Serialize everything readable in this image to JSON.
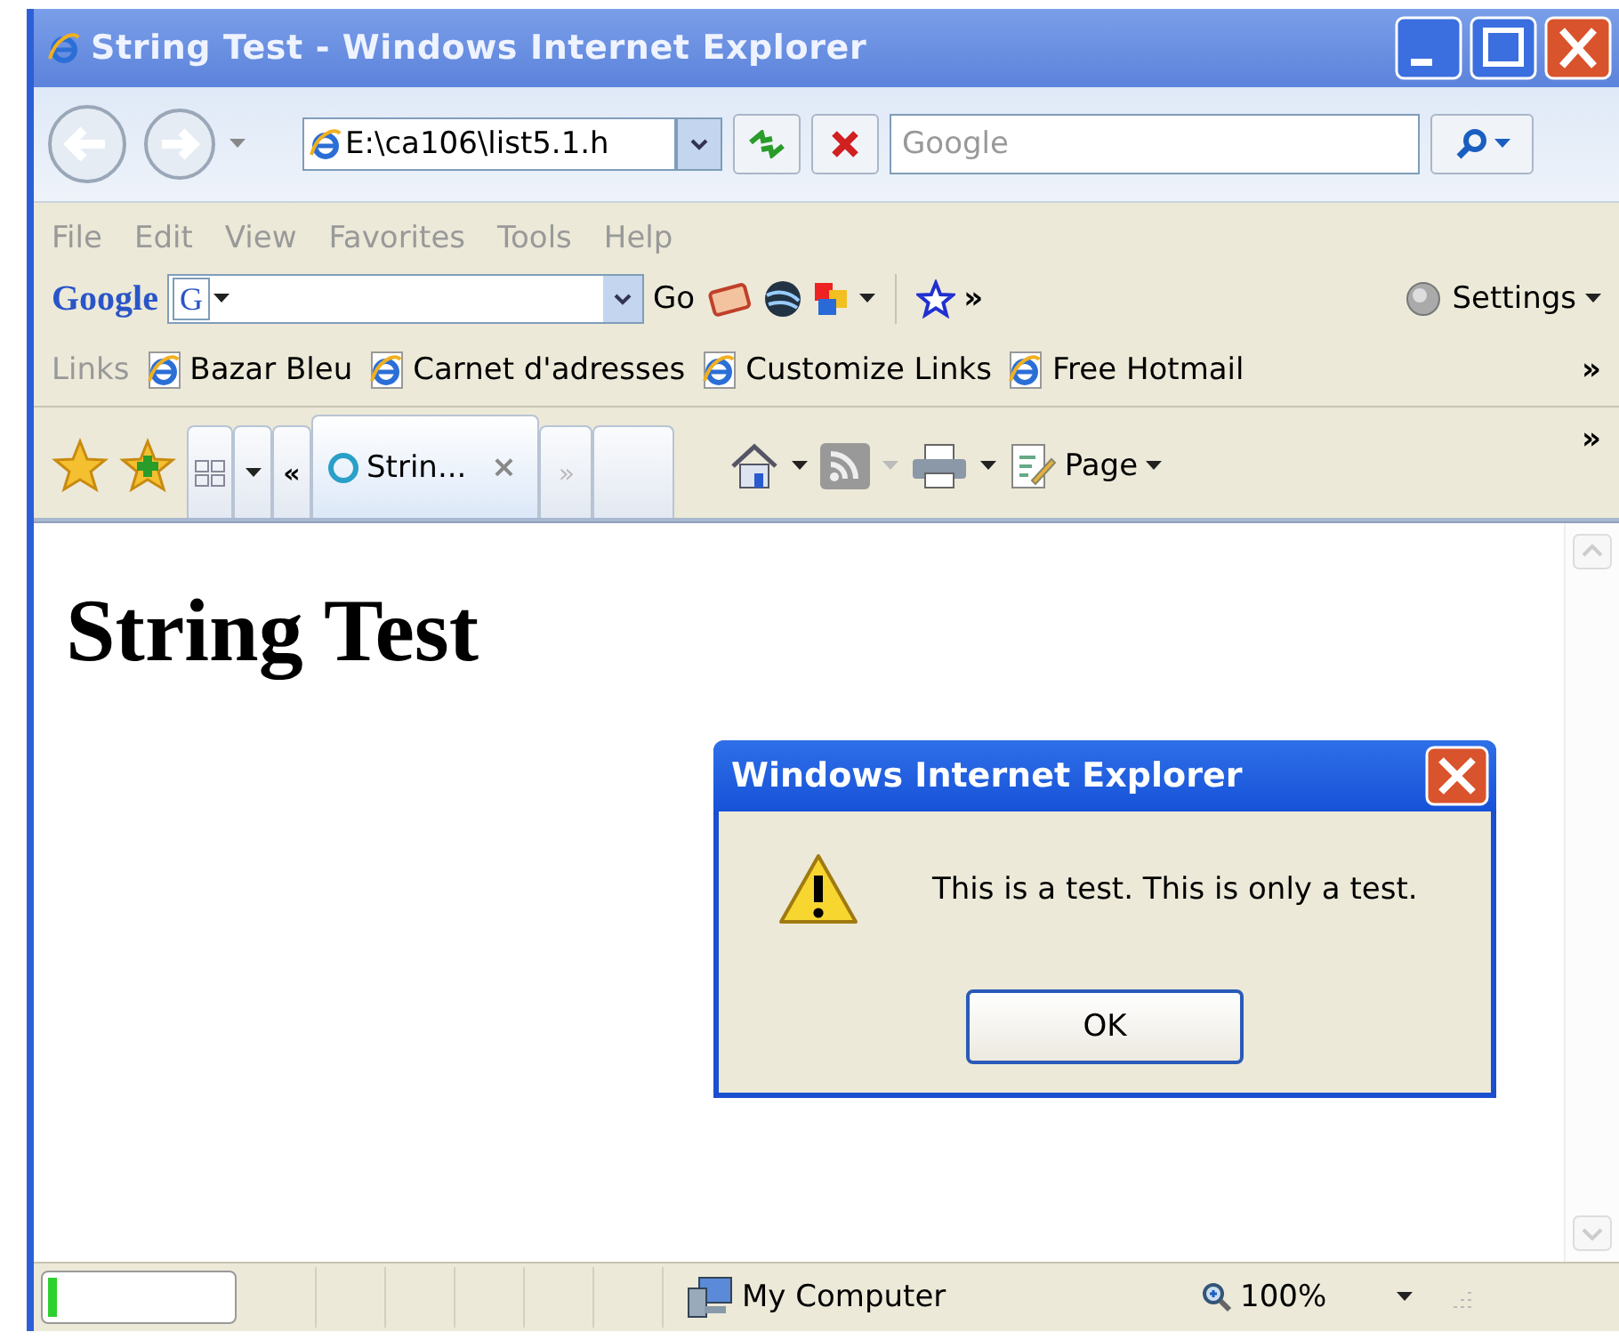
{
  "window": {
    "title": "String Test - Windows Internet Explorer"
  },
  "address_bar": {
    "value": "E:\\ca106\\list5.1.h",
    "search_placeholder": "Google"
  },
  "menu": [
    "File",
    "Edit",
    "View",
    "Favorites",
    "Tools",
    "Help"
  ],
  "google_toolbar": {
    "logo": "Google",
    "g_button": "G",
    "go": "Go",
    "more": "»",
    "settings": "Settings"
  },
  "links_bar": {
    "label": "Links",
    "items": [
      "Bazar Bleu",
      "Carnet d'adresses",
      "Customize Links",
      "Free Hotmail"
    ],
    "more": "»"
  },
  "command_bar": {
    "back_list": "«",
    "tabs": [
      {
        "label": "Strin...",
        "close": "×",
        "selected": true
      }
    ],
    "forward_list": "»",
    "page": "Page",
    "more": "»"
  },
  "content": {
    "heading": "String Test"
  },
  "dialog": {
    "title": "Windows Internet Explorer",
    "message": "This is a test. This is only a test.",
    "button": "OK"
  },
  "status_bar": {
    "progress": {
      "level": 0.05
    },
    "zone": "My Computer",
    "zoom": "100%"
  }
}
